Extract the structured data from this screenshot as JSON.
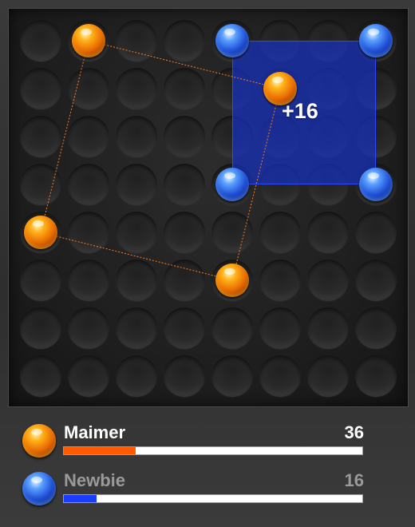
{
  "board": {
    "columns": 8,
    "rows": 8,
    "marbles": [
      {
        "col": 2,
        "row": 1,
        "color": "orange"
      },
      {
        "col": 5,
        "row": 1,
        "color": "blue"
      },
      {
        "col": 8,
        "row": 1,
        "color": "blue"
      },
      {
        "col": 6,
        "row": 2,
        "color": "orange"
      },
      {
        "col": 5,
        "row": 4,
        "color": "blue"
      },
      {
        "col": 8,
        "row": 4,
        "color": "blue"
      },
      {
        "col": 1,
        "row": 5,
        "color": "orange"
      },
      {
        "col": 5,
        "row": 6,
        "color": "orange"
      }
    ],
    "link_color": "#ff7a1a",
    "link_path": [
      [
        2,
        1
      ],
      [
        6,
        2
      ],
      [
        5,
        6
      ],
      [
        1,
        5
      ],
      [
        2,
        1
      ]
    ],
    "highlight": {
      "col_from": 5,
      "row_from": 1,
      "col_to": 8,
      "row_to": 4,
      "color": "#1630be"
    },
    "score_popup": "+16"
  },
  "players": [
    {
      "name": "Maimer",
      "score": "36",
      "color": "orange",
      "name_color": "#ffffff",
      "bar_color": "#ff5a00",
      "bar_fraction": 0.24
    },
    {
      "name": "Newbie",
      "score": "16",
      "color": "blue",
      "name_color": "#9a9a9a",
      "bar_color": "#1a3cff",
      "bar_fraction": 0.11
    }
  ]
}
